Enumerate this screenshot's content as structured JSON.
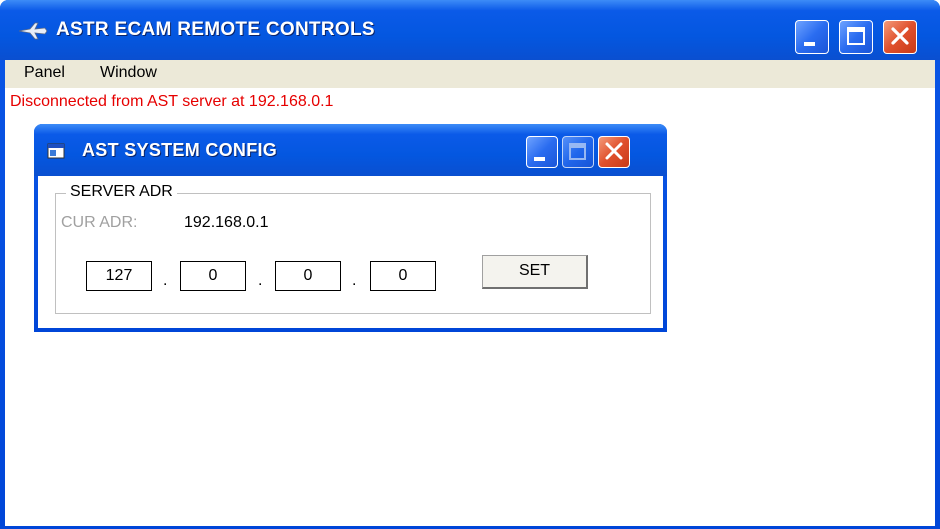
{
  "main_window": {
    "title": "ASTR ECAM REMOTE CONTROLS",
    "icon": "airplane-icon",
    "menu": [
      "Panel",
      "Window"
    ],
    "status_text": "Disconnected from AST server at 192.168.0.1",
    "status_color": "#e60000"
  },
  "config_window": {
    "title": "AST SYSTEM CONFIG",
    "icon": "window-icon",
    "group_label": "SERVER ADR",
    "current_address_label": "CUR ADR:",
    "current_address_value": "192.168.0.1",
    "ip_octets": [
      "127",
      "0",
      "0",
      "0"
    ],
    "ip_separator": ".",
    "set_label": "SET"
  },
  "colors": {
    "titlebar": "#0457e0",
    "close_button": "#e0502c",
    "menubar": "#ece9d8"
  }
}
